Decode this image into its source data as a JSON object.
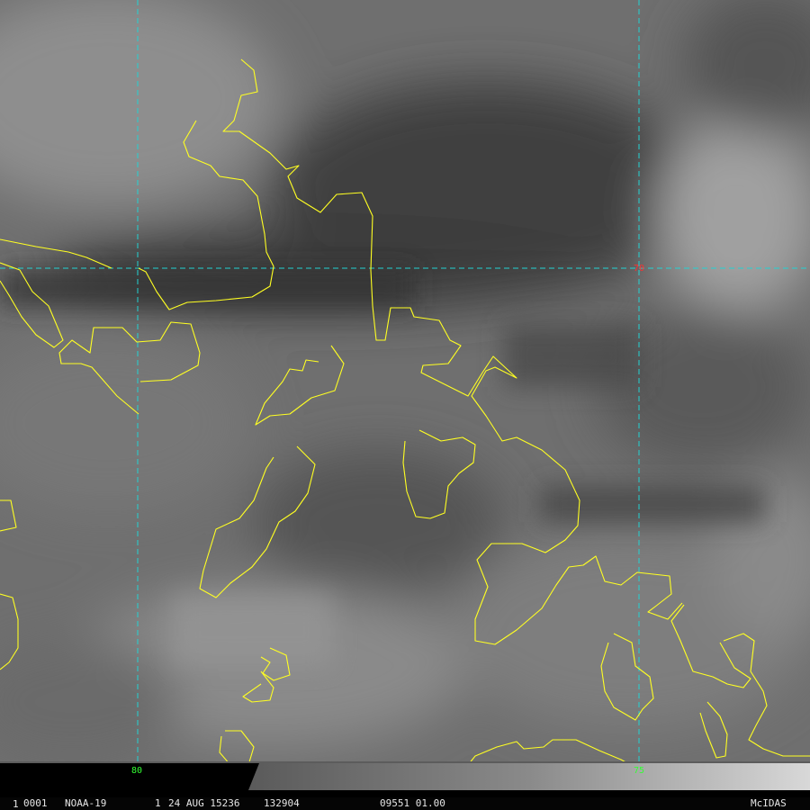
{
  "image": {
    "frame": "1",
    "sequence": "0001",
    "satellite": "NOAA-19",
    "band": "1",
    "date": "24 AUG 15236",
    "time": "132904",
    "position": "09551 01.00",
    "software": "McIDAS"
  },
  "grid": {
    "lat_label": "70",
    "lon_labels": [
      "80",
      "75"
    ]
  },
  "colors": {
    "grid": "#22d3d3",
    "coastline": "#ffff22",
    "lat_label": "#ff3030",
    "lon_label": "#33ff33",
    "frame_number": "#ffd21f",
    "software": "#ffd21f"
  }
}
